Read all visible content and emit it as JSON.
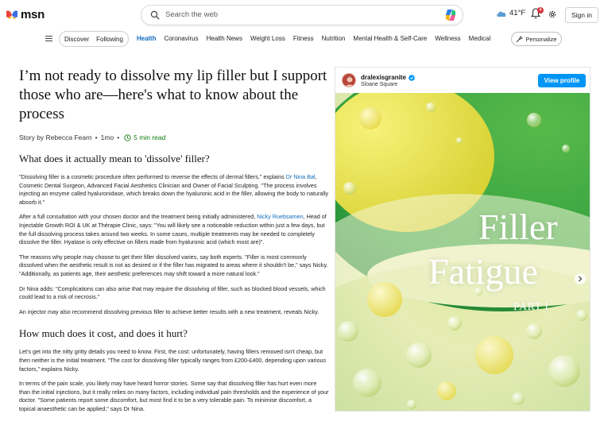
{
  "header": {
    "logo_text": "msn",
    "search_placeholder": "Search the web",
    "weather_temp": "41°F",
    "notification_count": "4",
    "signin_label": "Sign in"
  },
  "nav": {
    "segments": [
      "Discover",
      "Following"
    ],
    "links": [
      "Health",
      "Coronavirus",
      "Health News",
      "Weight Loss",
      "Fitness",
      "Nutrition",
      "Mental Health & Self-Care",
      "Wellness",
      "Medical"
    ],
    "active": "Health",
    "personalize_label": "Personalize"
  },
  "article": {
    "headline": "I’m not ready to dissolve my lip filler but I support those who are—here's what to know about the process",
    "byline_author": "Story by Rebecca Fearn",
    "byline_time": "1mo",
    "read_time": "5 min read",
    "section1_title": "What does it actually mean to 'dissolve' filler?",
    "p1_a": "\"Dissolving filler is a cosmetic procedure often performed to reverse the effects of dermal fillers,\" explains ",
    "p1_link": "Dr Nina Bal",
    "p1_b": ", Cosmetic Dental Surgeon, Advanced Facial Aesthetics Clinician and Owner of Facial Sculpting. \"The process involves injecting an enzyme called hyaluronidase, which breaks down the hyaluronic acid in the filler, allowing the body to naturally absorb it.\"",
    "p2_a": "After a full consultation with your chosen doctor and the treatment being initially administered, ",
    "p2_link": "Nicky Ruebsamen",
    "p2_b": ", Head of Injectable Growth ROI & UK at Thérapie Clinic, says: \"You will likely see a noticeable reduction within just a few days, but the full dissolving process takes around two weeks. In some cases, multiple treatments may be needed to completely dissolve the filler. Hyalase is only effective on fillers made from hyaluronic acid (which most are)\".",
    "p3": "The reasons why people may choose to get their filler dissolved varies, say both experts. \"Filler is most commonly dissolved when the aesthetic result is not as desired or if the filler has migrated to areas where it shouldn't be,\" says Nicky. \"Additionally, as patients age, their aesthetic preferences may shift toward a more natural look.\"",
    "p4": "Dr Nina adds: \"Complications can also arise that may require the dissolving of filler, such as blocked blood vessels, which could lead to a risk of necrosis.\"",
    "p5": "An injector may also recommend dissolving previous filler to achieve better results with a new treatment, reveals Nicky.",
    "section2_title": "How much does it cost, and does it hurt?",
    "p6": "Let's get into the nitty gritty details you need to know. First, the cost: unfortunately, having fillers removed isn't cheap, but then neither is the initial treatment. \"The cost for dissolving filler typically ranges from £200-£400, depending upon various factors,\" explains Nicky.",
    "p7": "In terms of the pain scale, you likely may have heard horror stories. Some say that dissolving filler has hurt even more than the initial injections, but it really relies on many factors, including individual pain thresholds and the experience of your doctor. \"Some patients report some discomfort, but most find it to be a very tolerable pain. To minimise discomfort, a topical anaesthetic can be applied,\" says Dr Nina."
  },
  "embed": {
    "handle": "dralexisgranite",
    "location": "Sloane Square",
    "view_profile_label": "View profile",
    "image_title_line1": "Filler",
    "image_title_line2": "Fatigue",
    "image_title_line3": "PART I"
  },
  "colors": {
    "accent": "#0f6cbd",
    "link": "#0f6cbd",
    "read_time": "#0e7a0d",
    "instagram_button": "#0095f6"
  }
}
